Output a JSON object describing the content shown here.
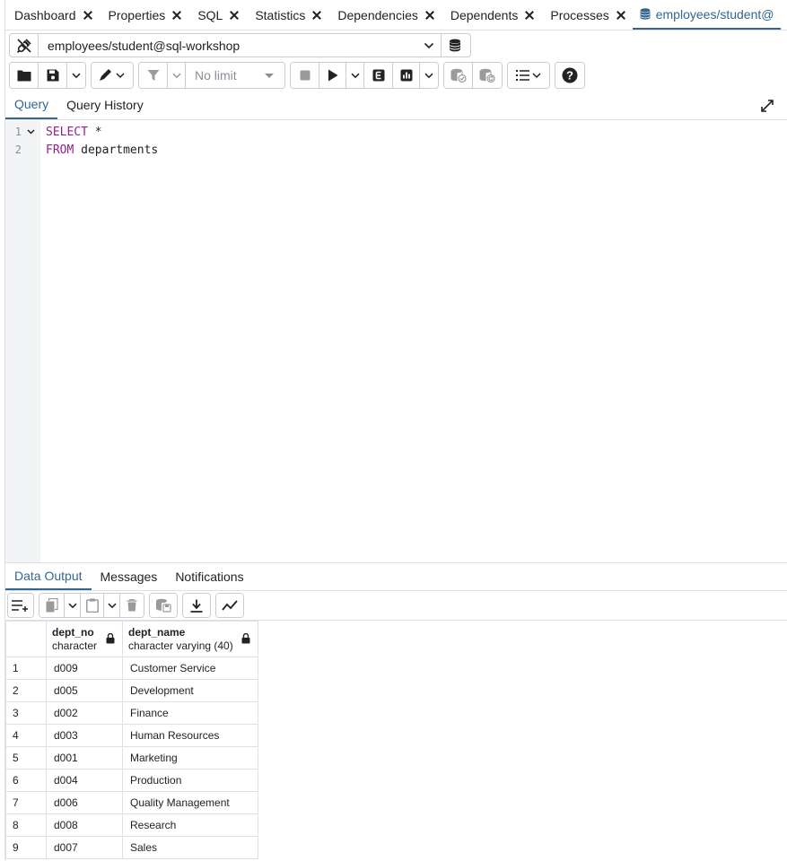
{
  "tabs": [
    {
      "label": "Dashboard",
      "closable": true
    },
    {
      "label": "Properties",
      "closable": true
    },
    {
      "label": "SQL",
      "closable": true
    },
    {
      "label": "Statistics",
      "closable": true
    },
    {
      "label": "Dependencies",
      "closable": true
    },
    {
      "label": "Dependents",
      "closable": true
    },
    {
      "label": "Processes",
      "closable": true
    },
    {
      "label": "employees/student@",
      "active": true
    }
  ],
  "connection": {
    "label": "employees/student@sql-workshop"
  },
  "toolbar": {
    "limit_label": "No limit"
  },
  "query_tabs": [
    "Query",
    "Query History"
  ],
  "editor": {
    "lines": [
      {
        "number": "1",
        "keyword": "SELECT",
        "rest": " *"
      },
      {
        "number": "2",
        "keyword": "FROM",
        "rest": " departments"
      }
    ]
  },
  "bottom_tabs": [
    "Data Output",
    "Messages",
    "Notifications"
  ],
  "results": {
    "columns": [
      {
        "name": "dept_no",
        "type": "character"
      },
      {
        "name": "dept_name",
        "type": "character varying (40)"
      }
    ],
    "rows": [
      [
        "1",
        "d009",
        "Customer Service"
      ],
      [
        "2",
        "d005",
        "Development"
      ],
      [
        "3",
        "d002",
        "Finance"
      ],
      [
        "4",
        "d003",
        "Human Resources"
      ],
      [
        "5",
        "d001",
        "Marketing"
      ],
      [
        "6",
        "d004",
        "Production"
      ],
      [
        "7",
        "d006",
        "Quality Management"
      ],
      [
        "8",
        "d008",
        "Research"
      ],
      [
        "9",
        "d007",
        "Sales"
      ]
    ]
  },
  "colors": {
    "accent": "#326690",
    "keyword": "#9a1c8e",
    "border": "#dde0e6"
  }
}
